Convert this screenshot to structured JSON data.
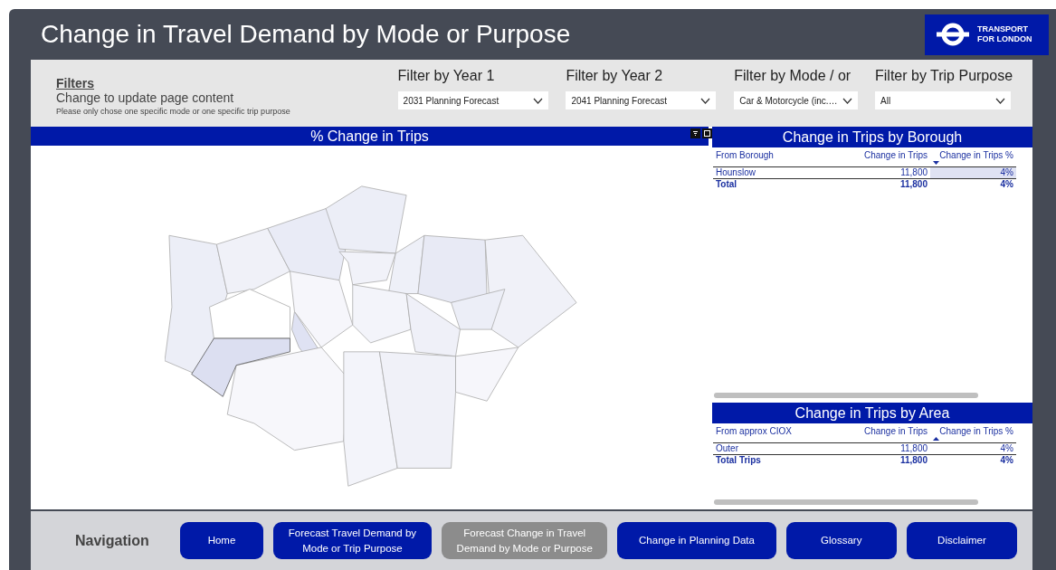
{
  "header": {
    "title": "Change in Travel Demand by Mode or Purpose",
    "logo_lines": [
      "TRANSPORT",
      "FOR LONDON"
    ]
  },
  "filters": {
    "heading": "Filters",
    "subtitle": "Change to update page content",
    "note": "Please only chose one specific mode or one specific trip purpose",
    "slicers": [
      {
        "label": "Filter by Year 1",
        "value": "2031 Planning Forecast"
      },
      {
        "label": "Filter by Year 2",
        "value": "2041 Planning Forecast"
      },
      {
        "label": "Filter by Mode / or",
        "value": "Car & Motorcycle (inc.…"
      },
      {
        "label": "Filter by Trip Purpose",
        "value": "All"
      }
    ]
  },
  "map_panel": {
    "title": "% Change in Trips"
  },
  "tables": [
    {
      "title": "Change in Trips by Borough",
      "columns": [
        {
          "label": "From Borough",
          "sorted": false
        },
        {
          "label": "Change in Trips",
          "sorted": false
        },
        {
          "label": "Change in Trips %",
          "sorted": true,
          "sort_ascending": false
        }
      ],
      "rows": [
        {
          "cells": [
            "Hounslow",
            "11,800",
            "4%"
          ],
          "selected": true
        }
      ],
      "total": [
        "Total",
        "11,800",
        "4%"
      ]
    },
    {
      "title": "Change in Trips by Area",
      "columns": [
        {
          "label": "From approx CIOX",
          "sorted": false
        },
        {
          "label": "Change in Trips",
          "sorted": false
        },
        {
          "label": "Change in Trips %",
          "sorted": true,
          "sort_ascending": true
        }
      ],
      "rows": [
        {
          "cells": [
            "Outer",
            "11,800",
            "4%"
          ],
          "selected": false
        }
      ],
      "total": [
        "Total Trips",
        "11,800",
        "4%"
      ]
    }
  ],
  "navigation": {
    "label": "Navigation",
    "buttons": [
      {
        "label": "Home",
        "selected": false
      },
      {
        "label": "Forecast Travel Demand by Mode or Trip Purpose",
        "selected": false
      },
      {
        "label": "Forecast Change in Travel Demand by Mode or Purpose",
        "selected": true
      },
      {
        "label": "Change in Planning Data",
        "selected": false
      },
      {
        "label": "Glossary",
        "selected": false
      },
      {
        "label": "Disclaimer",
        "selected": false
      }
    ]
  }
}
